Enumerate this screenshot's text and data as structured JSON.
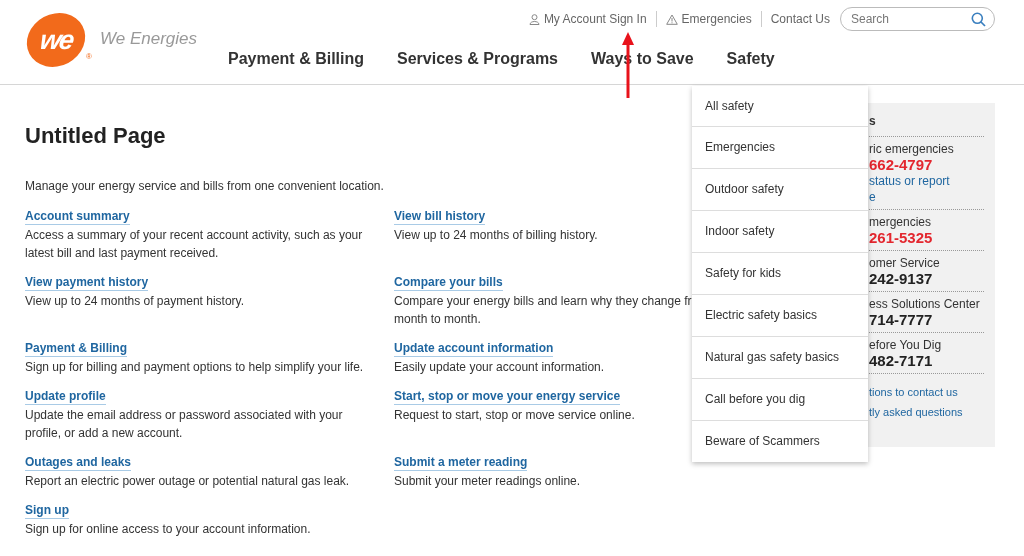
{
  "logo": {
    "mark": "we",
    "registered": "®",
    "name": "We Energies"
  },
  "utility_links": [
    {
      "kind": "account",
      "label": "My Account Sign In"
    },
    {
      "kind": "warning",
      "label": "Emergencies"
    },
    {
      "kind": "plain",
      "label": "Contact Us"
    }
  ],
  "search": {
    "placeholder": "Search"
  },
  "nav": [
    {
      "label": "Payment & Billing",
      "selected": false
    },
    {
      "label": "Services & Programs",
      "selected": false
    },
    {
      "label": "Ways to Save",
      "selected": false
    },
    {
      "label": "Safety",
      "selected": true
    }
  ],
  "page": {
    "title": "Untitled Page",
    "intro": "Manage your energy service and bills from one convenient location."
  },
  "links": [
    {
      "title": "Account summary",
      "description": "Access a summary of your recent account activity, such as your latest bill and last payment received."
    },
    {
      "title": "View bill history",
      "description": "View up to 24 months of billing history."
    },
    {
      "title": "View payment history",
      "description": "View up to 24 months of payment history."
    },
    {
      "title": "Compare your bills",
      "description": "Compare your energy bills and learn why they change fr\nmonth to month."
    },
    {
      "title": "Payment & Billing",
      "description": "Sign up for billing and payment options to help simplify your life."
    },
    {
      "title": "Update account information",
      "description": "Easily update your account information."
    },
    {
      "title": "Update profile",
      "description": "Update the email address or password associated with your profile, or add a new account."
    },
    {
      "title": "Start, stop or move your energy service",
      "description": "Request to start, stop or move service online."
    },
    {
      "title": "Outages and leaks",
      "description": "Report an electric power outage or potential natural gas leak."
    },
    {
      "title": "Submit a meter reading",
      "description": "Submit your meter readings online."
    },
    {
      "title": "Sign up",
      "description": "Sign up for online access to your account information."
    }
  ],
  "sidebar": {
    "heading": "s",
    "groups": [
      {
        "label": "ric emergencies",
        "phone": "662-4797",
        "urgent": true,
        "links": [
          "status or report",
          "e"
        ]
      },
      {
        "label": "mergencies",
        "phone": "261-5325",
        "urgent": true
      },
      {
        "label": "omer Service",
        "phone": "242-9137",
        "urgent": false
      },
      {
        "label": "ess Solutions Center",
        "phone": "714-7777",
        "urgent": false
      },
      {
        "label": "efore You Dig",
        "phone": "482-7171",
        "urgent": false
      }
    ],
    "footer_links": [
      "tions to contact us",
      "tly asked questions"
    ]
  },
  "dropdown": {
    "items": [
      "All safety",
      "Emergencies",
      "Outdoor safety",
      "Indoor safety",
      "Safety for kids",
      "Electric safety basics",
      "Natural gas safety basics",
      "Call before you dig",
      "Beware of Scammers"
    ]
  }
}
